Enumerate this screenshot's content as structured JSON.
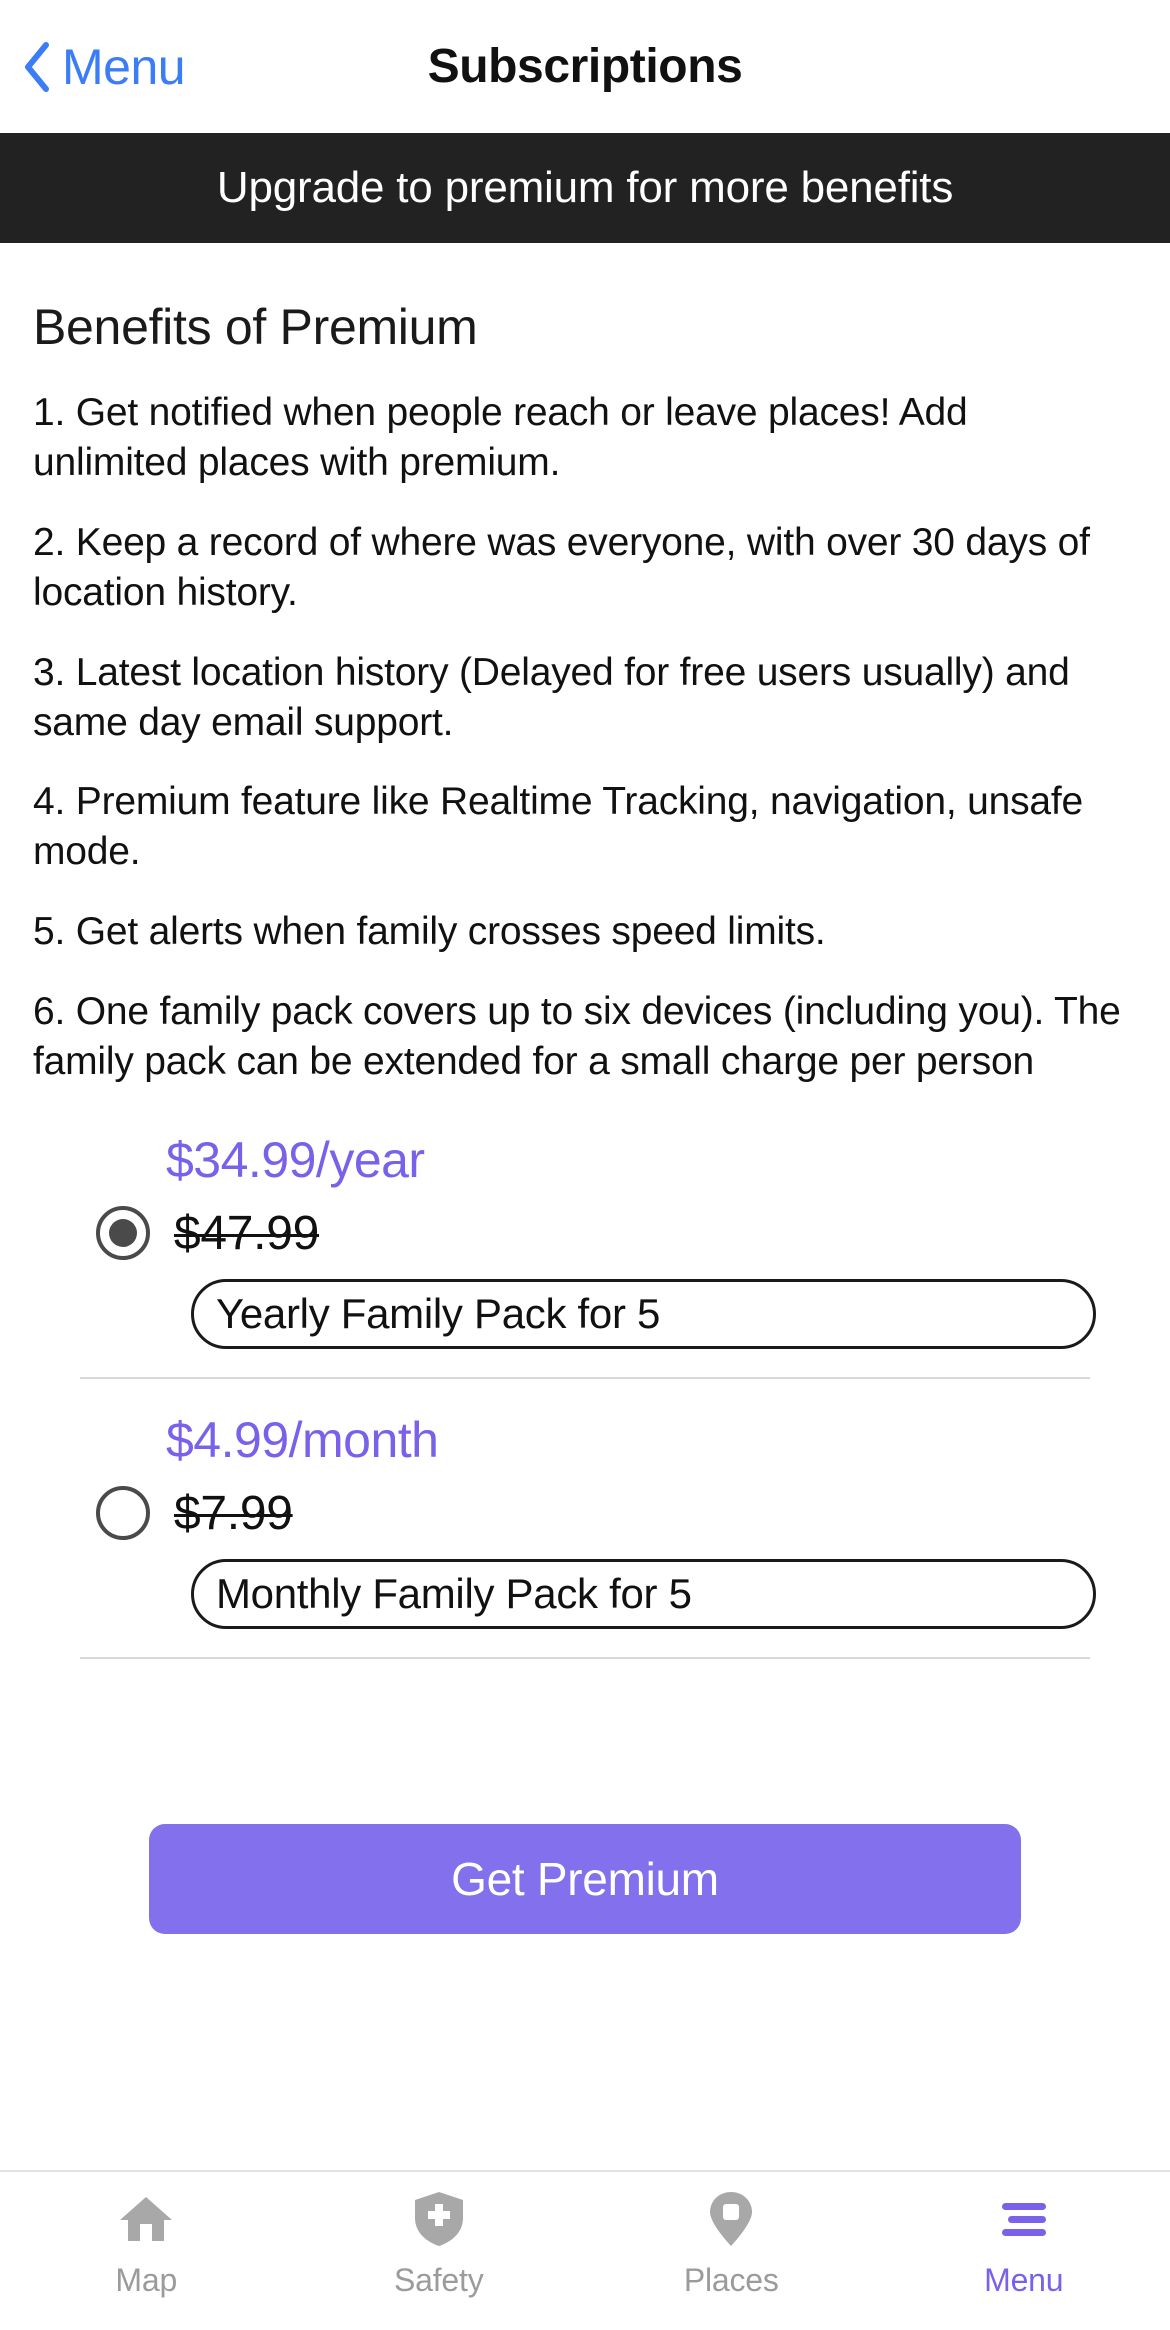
{
  "colors": {
    "accent_purple": "#7a61ea",
    "button_purple": "#8370ec",
    "link_blue": "#3b7df6",
    "banner_bg": "#222222",
    "muted_gray": "#9b9b9b"
  },
  "navbar": {
    "back_label": "Menu",
    "title": "Subscriptions"
  },
  "banner": {
    "text": "Upgrade to premium for more benefits"
  },
  "main": {
    "section_title": "Benefits of Premium",
    "benefits": [
      "1. Get notified when people reach or leave places! Add unlimited places with premium.",
      "2. Keep a record of where was everyone, with over 30 days of location history.",
      "3. Latest location history (Delayed for free users usually) and same day email support.",
      "4. Premium feature like Realtime Tracking, navigation, unsafe mode.",
      "5. Get alerts when family crosses speed limits.",
      "6. One family pack covers up to six devices (including you). The family pack can be extended for a small charge per person"
    ]
  },
  "plans": [
    {
      "price": "$34.99/year",
      "old_price": "$47.99",
      "pill_label": "Yearly Family Pack for 5",
      "selected": true
    },
    {
      "price": "$4.99/month",
      "old_price": "$7.99",
      "pill_label": "Monthly Family Pack for 5",
      "selected": false
    }
  ],
  "cta": {
    "label": "Get Premium"
  },
  "tabbar": {
    "items": [
      {
        "label": "Map",
        "icon": "home-icon",
        "active": false
      },
      {
        "label": "Safety",
        "icon": "shield-cross-icon",
        "active": false
      },
      {
        "label": "Places",
        "icon": "map-pin-icon",
        "active": false
      },
      {
        "label": "Menu",
        "icon": "hamburger-menu-icon",
        "active": true
      }
    ]
  }
}
